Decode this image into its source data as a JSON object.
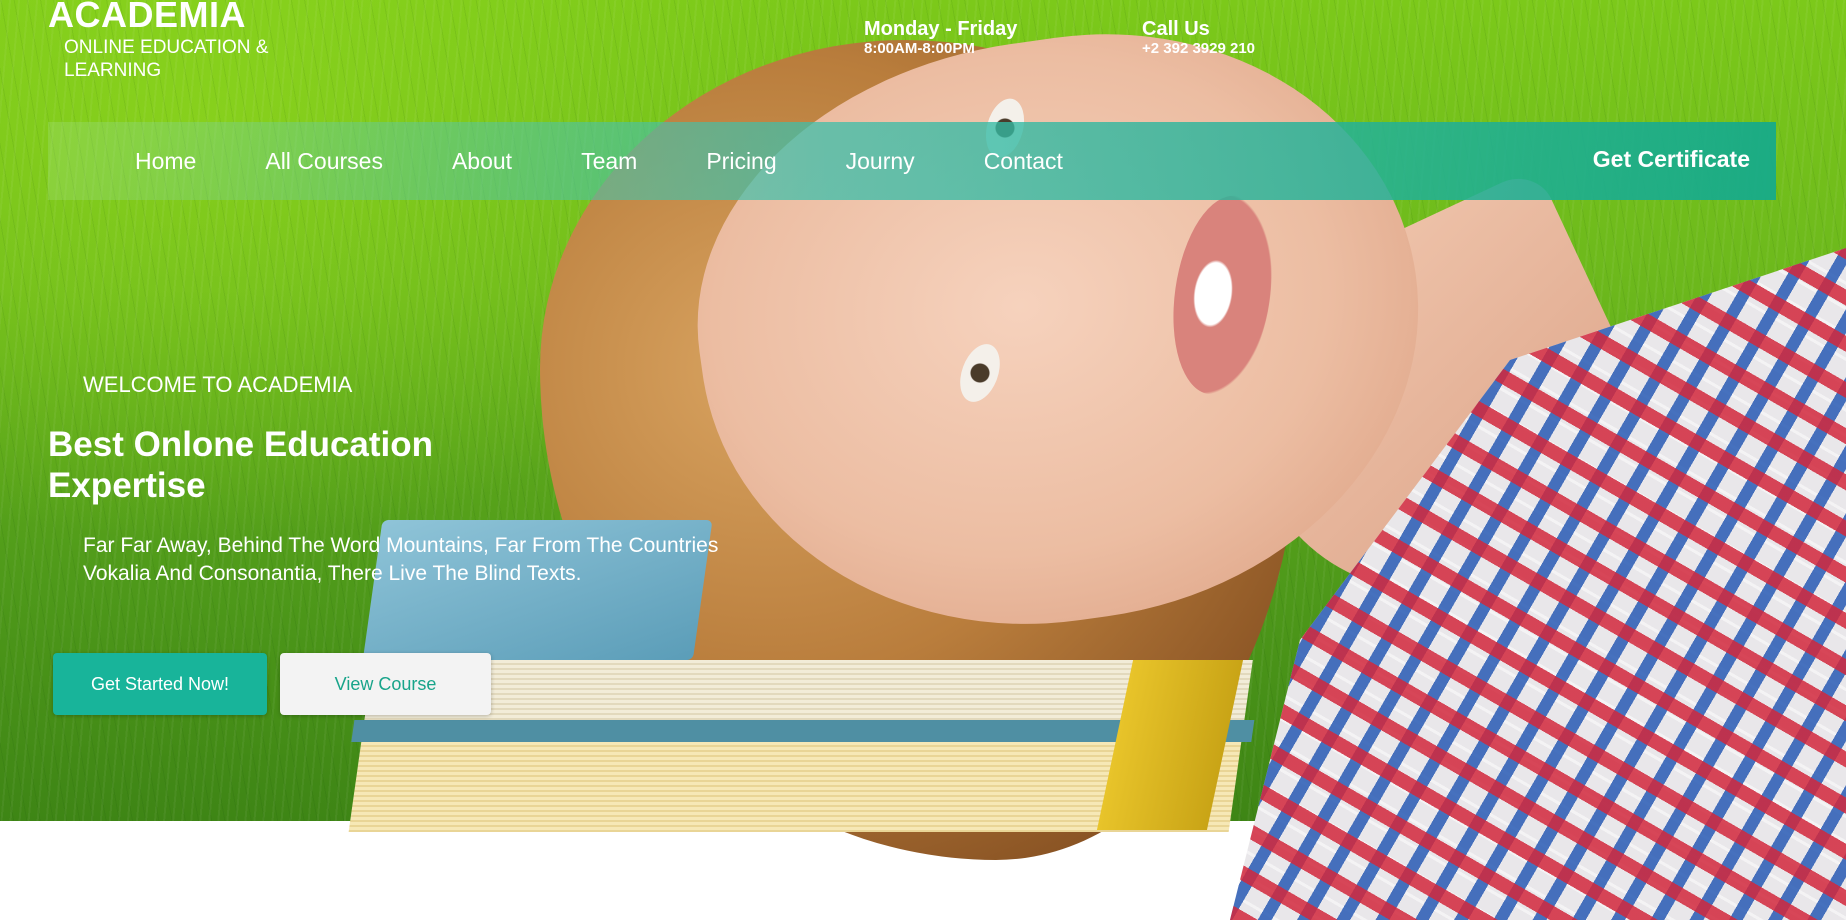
{
  "brand": {
    "title": "ACADEMIA",
    "subtitle": "ONLINE EDUCATION & LEARNING"
  },
  "hours": {
    "title": "Monday - Friday",
    "value": "8:00AM-8:00PM"
  },
  "call": {
    "title": "Call Us",
    "value": "+2 392 3929 210"
  },
  "nav": {
    "items": [
      {
        "label": "Home"
      },
      {
        "label": "All Courses"
      },
      {
        "label": "About"
      },
      {
        "label": "Team"
      },
      {
        "label": "Pricing"
      },
      {
        "label": "Journy"
      },
      {
        "label": "Contact"
      }
    ],
    "cta": "Get Certificate"
  },
  "hero": {
    "welcome": "WELCOME TO ACADEMIA",
    "headline": "Best Onlone Education Expertise",
    "description": "Far Far Away, Behind The Word Mountains, Far From The Countries Vokalia And Consonantia, There Live The Blind Texts.",
    "primary_button": "Get Started Now!",
    "secondary_button": "View Course"
  },
  "colors": {
    "accent": "#18b49a",
    "nav_end": "#14aa8c",
    "grass": "#6cb81c"
  }
}
